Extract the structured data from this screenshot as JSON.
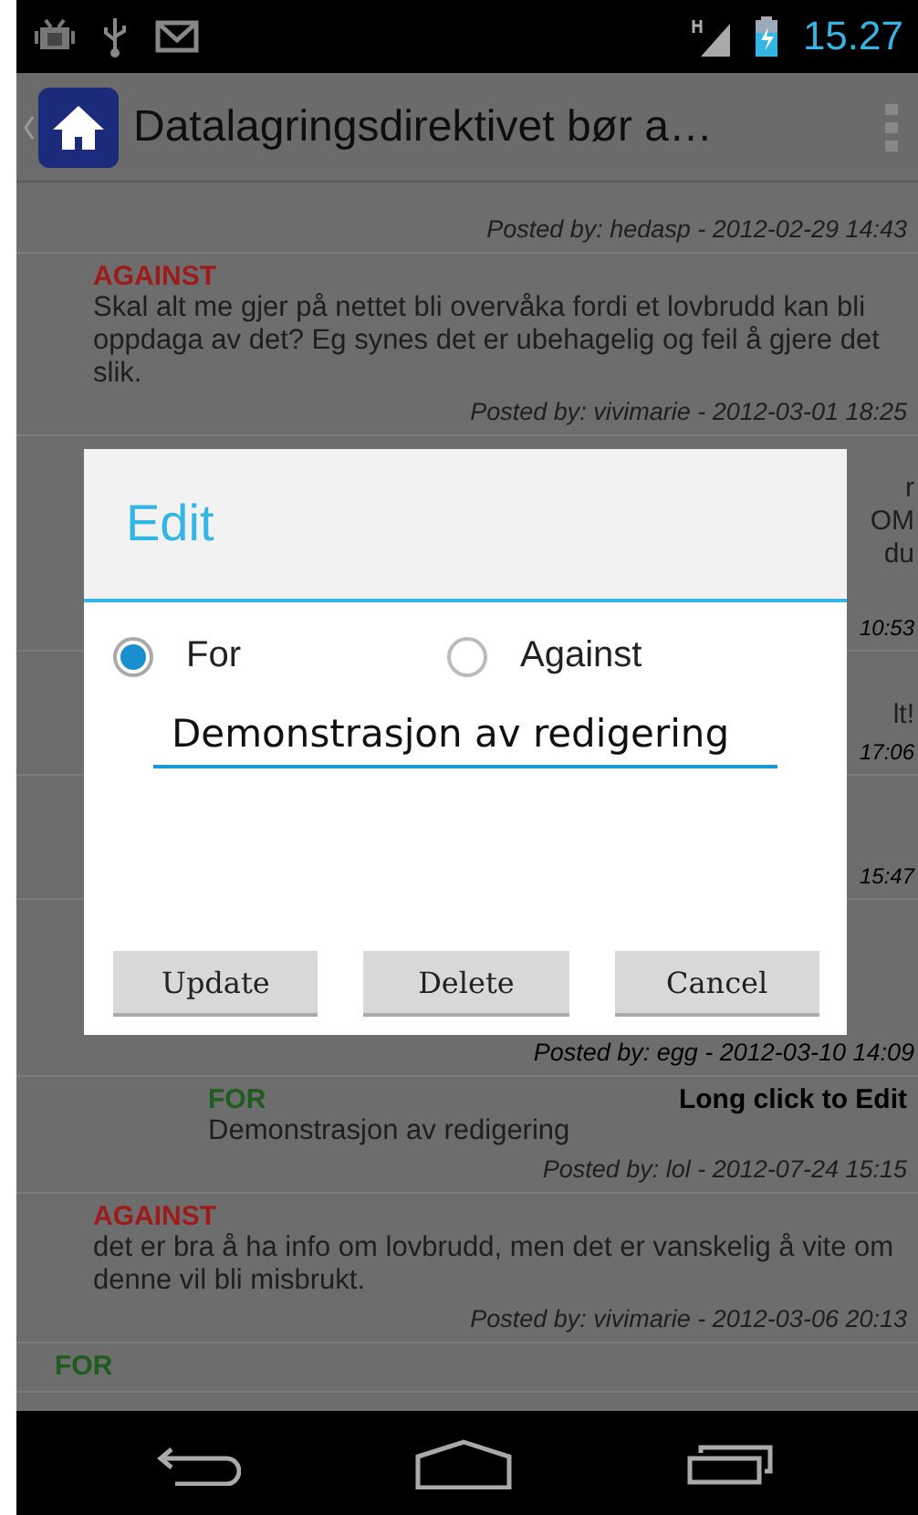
{
  "status_bar": {
    "time": "15.27"
  },
  "action_bar": {
    "title": "Datalagringsdirektivet bør a…"
  },
  "posts": [
    {
      "kind": "reply",
      "footer": "Posted by: hedasp  -  2012-02-29 14:43"
    },
    {
      "kind": "reply",
      "color": "#9e1b1b",
      "stance": "AGAINST",
      "text": "Skal alt me gjer på nettet bli overvåka fordi et lovbrudd kan bli oppdaga av det? Eg synes det er ubehagelig og feil å gjere det slik.",
      "footer": "Posted by: vivimarie  -  2012-03-01 18:25"
    },
    {
      "kind": "covered",
      "lines": [
        "r",
        "OM",
        "du"
      ],
      "footer": "10:53"
    },
    {
      "kind": "covered",
      "lines": [
        "lt!"
      ],
      "footer": "17:06"
    },
    {
      "kind": "covered",
      "footer": "15:47"
    },
    {
      "kind": "covered",
      "footer": "Posted by: egg  -  2012-03-10 14:09",
      "children": [
        {
          "color": "#1f5c1f",
          "stance": "FOR",
          "hint": "Long click to Edit",
          "text": "Demonstrasjon av redigering",
          "footer": "Posted by: lol  -  2012-07-24 15:15"
        }
      ]
    },
    {
      "kind": "reply",
      "color": "#9e1b1b",
      "stance": "AGAINST",
      "text": "det er bra å ha info om lovbrudd, men det er vanskelig å vite om denne vil bli misbrukt.",
      "footer": "Posted by: vivimarie  -  2012-03-06 20:13"
    },
    {
      "kind": "argument",
      "color": "#1f5c1f",
      "stance": "FOR"
    }
  ],
  "dialog": {
    "title": "Edit",
    "options": [
      {
        "label": "For",
        "selected": true
      },
      {
        "label": "Against",
        "selected": false
      }
    ],
    "field": {
      "value": "Demonstrasjon av redigering"
    },
    "buttons": [
      "Update",
      "Delete",
      "Cancel"
    ]
  }
}
